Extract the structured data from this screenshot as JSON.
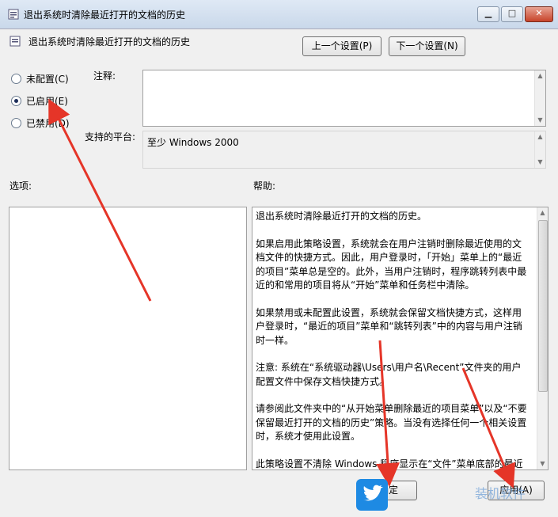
{
  "window": {
    "title": "退出系统时清除最近打开的文档的历史",
    "buttons": {
      "min": "▁",
      "max": "□",
      "close": "✕"
    }
  },
  "header": {
    "policy_title": "退出系统时清除最近打开的文档的历史",
    "prev_button": "上一个设置(P)",
    "next_button": "下一个设置(N)"
  },
  "options": {
    "not_configured": "未配置(C)",
    "enabled": "已启用(E)",
    "disabled": "已禁用(D)",
    "selected": "enabled"
  },
  "comment": {
    "label": "注释:",
    "value": ""
  },
  "platform": {
    "label": "支持的平台:",
    "value": "至少 Windows 2000"
  },
  "options_panel": {
    "label": "选项:"
  },
  "help": {
    "label": "帮助:",
    "paragraphs": [
      "退出系统时清除最近打开的文档的历史。",
      "如果启用此策略设置，系统就会在用户注销时删除最近使用的文档文件的快捷方式。因此，用户登录时，「开始」菜单上的“最近的项目”菜单总是空的。此外，当用户注销时，程序跳转列表中最近的和常用的项目将从“开始”菜单和任务栏中清除。",
      "如果禁用或未配置此设置，系统就会保留文档快捷方式，这样用户登录时，“最近的项目”菜单和“跳转列表”中的内容与用户注销时一样。",
      "注意: 系统在“系统驱动器\\Users\\用户名\\Recent”文件夹的用户配置文件中保存文档快捷方式。",
      "请参阅此文件夹中的“从开始菜单删除最近的项目菜单”以及“不要保留最近打开的文档的历史”策略。当没有选择任何一个相关设置时，系统才使用此设置。",
      "此策略设置不清除 Windows 程序显示在“文件”菜单底部的最近"
    ]
  },
  "footer": {
    "ok_button": "确定",
    "apply_button": "应用(A)"
  },
  "watermark": {
    "text": "装机软件"
  },
  "colors": {
    "arrow": "#e53528",
    "title_gradient_top": "#dfe9f5",
    "close_red": "#c7432a"
  }
}
